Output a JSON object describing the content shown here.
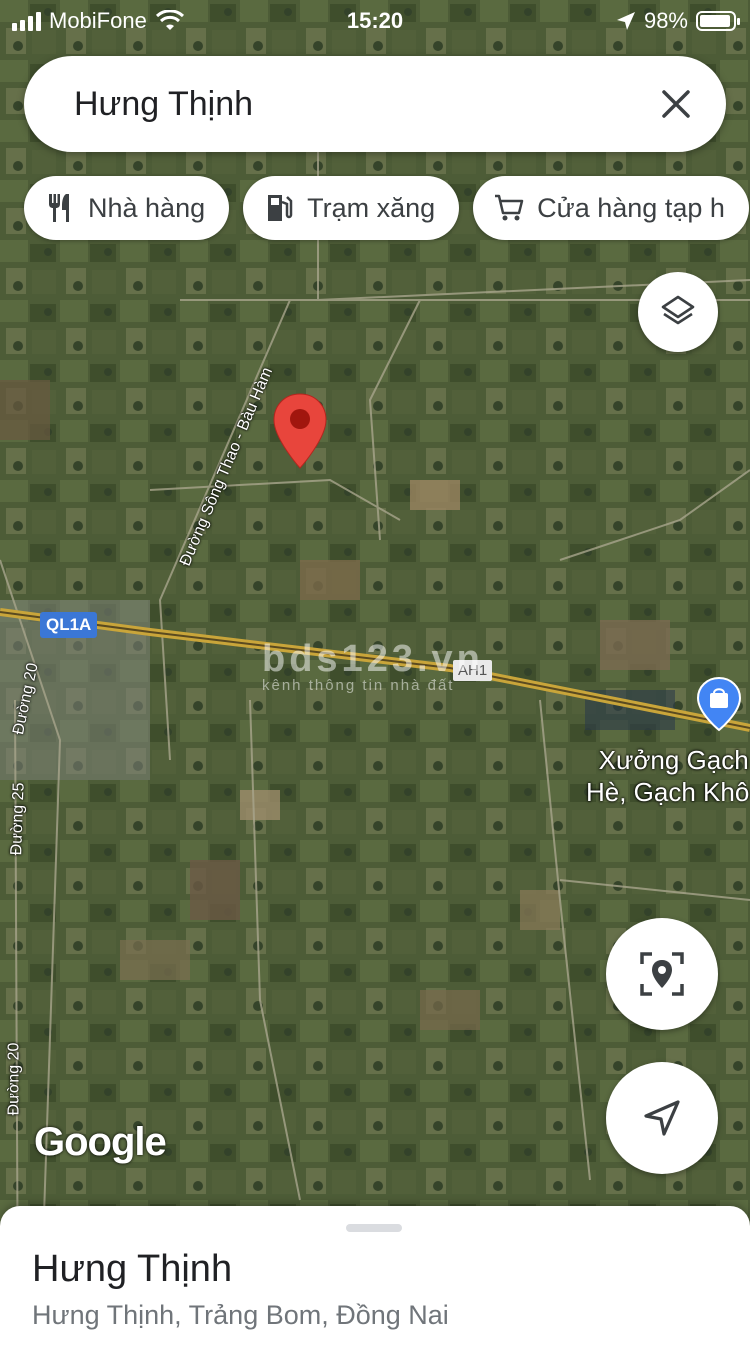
{
  "status_bar": {
    "carrier": "MobiFone",
    "time": "15:20",
    "battery": "98%"
  },
  "search": {
    "value": "Hưng Thịnh"
  },
  "chips": [
    {
      "label": "Nhà hàng",
      "icon": "fork-knife-icon"
    },
    {
      "label": "Trạm xăng",
      "icon": "gas-station-icon"
    },
    {
      "label": "Cửa hàng tạp h",
      "icon": "shopping-cart-icon"
    }
  ],
  "map": {
    "road_labels": [
      "Đường Sông Thao - Bàu Hàm",
      "Đường 20",
      "Đường 25",
      "Đường 20"
    ],
    "highway_shield": "QL1A",
    "asian_highway_shield": "AH1",
    "watermark_main": "bds123.vn",
    "watermark_sub": "kênh thông tin nhà đất",
    "poi_label_line1": "Xưởng Gạch",
    "poi_label_line2": "Hè, Gạch Khô",
    "attribution": "Google"
  },
  "place": {
    "name": "Hưng Thịnh",
    "address": "Hưng Thịnh, Trảng Bom, Đồng Nai"
  },
  "colors": {
    "pin": "#e8453c",
    "road": "#c9a53a",
    "shield": "#3b77d6",
    "poi": "#4285f4"
  }
}
